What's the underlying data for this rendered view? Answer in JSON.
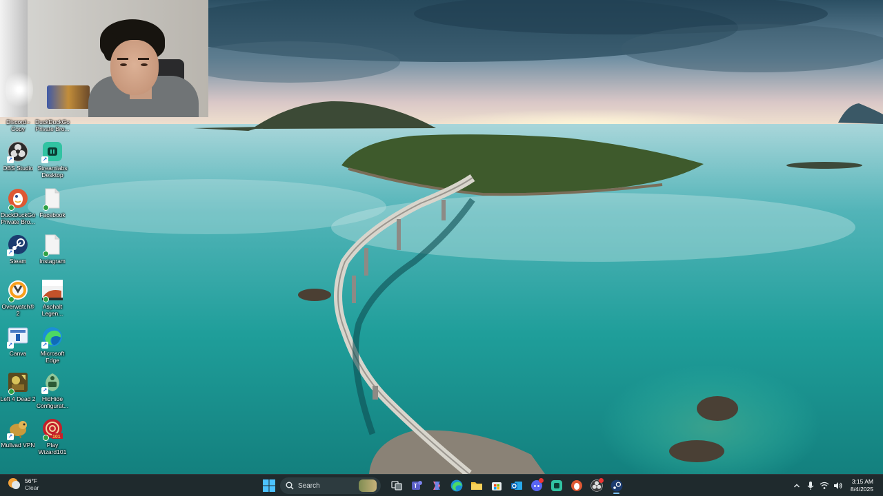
{
  "desktop_icons": [
    {
      "id": "discord-copy",
      "label": "Discord - Copy",
      "icon": "discord-icon"
    },
    {
      "id": "duckduckgo-top",
      "label": "DuckDuckGo Private Bro...",
      "icon": "duckduckgo-icon"
    },
    {
      "id": "obs",
      "label": "OBS Studio",
      "icon": "obs-icon"
    },
    {
      "id": "streamlabs",
      "label": "Streamlabs Desktop",
      "icon": "streamlabs-icon"
    },
    {
      "id": "duckduckgo",
      "label": "DuckDuckGo Private Bro...",
      "icon": "duckduckgo-icon"
    },
    {
      "id": "facebook",
      "label": "Facebook",
      "icon": "file-icon"
    },
    {
      "id": "steam",
      "label": "Steam",
      "icon": "steam-icon"
    },
    {
      "id": "instagram",
      "label": "Instagram",
      "icon": "file-icon"
    },
    {
      "id": "overwatch",
      "label": "Overwatch® 2",
      "icon": "overwatch-icon"
    },
    {
      "id": "asphalt",
      "label": "Asphalt Legen...",
      "icon": "asphalt-icon"
    },
    {
      "id": "canva",
      "label": "Canva",
      "icon": "canva-icon"
    },
    {
      "id": "edge",
      "label": "Microsoft Edge",
      "icon": "edge-icon"
    },
    {
      "id": "l4d2",
      "label": "Left 4 Dead 2",
      "icon": "left4dead-icon"
    },
    {
      "id": "hidhide",
      "label": "HidHide Configurat...",
      "icon": "hidhide-icon"
    },
    {
      "id": "mullvad",
      "label": "Mullvad VPN",
      "icon": "mullvad-icon"
    },
    {
      "id": "wizard101",
      "label": "Play Wizard101",
      "icon": "wizard101-icon"
    }
  ],
  "taskbar": {
    "weather": {
      "temp": "56°F",
      "condition": "Clear"
    },
    "search_placeholder": "Search",
    "apps": [
      {
        "id": "task-view",
        "color": "#bfc6cc"
      },
      {
        "id": "teams",
        "color": "#5b5fc7"
      },
      {
        "id": "copilot",
        "color": "#e86ea4"
      },
      {
        "id": "edge",
        "color": "#2aa6d8"
      },
      {
        "id": "file-explorer",
        "color": "#f2c23a"
      },
      {
        "id": "microsoft-store",
        "color": "#e8eef0"
      },
      {
        "id": "outlook",
        "color": "#1a73d0"
      },
      {
        "id": "discord",
        "color": "#5865f2"
      },
      {
        "id": "streamlabs",
        "color": "#5fe0c0"
      },
      {
        "id": "duckduckgo",
        "color": "#de5833"
      },
      {
        "id": "obs",
        "color": "#3a3a3a"
      },
      {
        "id": "steam",
        "color": "#1b2838"
      }
    ],
    "time": "3:15 AM",
    "date": "8/4/2025"
  }
}
